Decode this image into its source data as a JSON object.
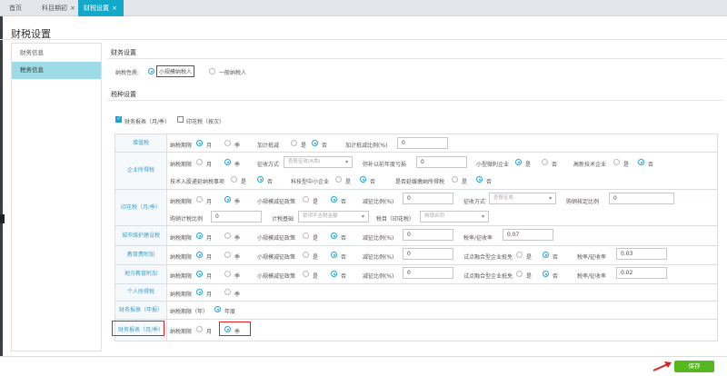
{
  "tabs": [
    {
      "label": "首页"
    },
    {
      "label": "科目期初",
      "close": "×"
    },
    {
      "label": "财税设置",
      "close": "×"
    }
  ],
  "page_title": "财税设置",
  "sidebar": {
    "items": [
      {
        "label": "财务信息"
      },
      {
        "label": "税务信息"
      }
    ]
  },
  "finance_settings": {
    "heading": "财务设置",
    "nature_label": "纳税性质:",
    "small_scale": "小规模纳税人",
    "general": "一般纳税人"
  },
  "tax_settings": {
    "heading": "税种设置",
    "financial_report_check": "财务报表（月/季）",
    "stamp_tax_check": "印花税（按次）"
  },
  "common": {
    "period": "纳税期限",
    "month": "月",
    "quarter": "季",
    "yes": "是",
    "no": "否",
    "year": "年度",
    "period_year": "纳税期限（年）"
  },
  "rows": {
    "vat": {
      "label": "增值税",
      "extra_deduct": "加计抵减",
      "extra_ratio": "加计抵减比例(%)",
      "extra_ratio_value": "0"
    },
    "cit": {
      "label": "企业所得税",
      "method": "征收方式",
      "method_placeholder": "查账征收(A类)",
      "prior_loss": "弥补以前年度亏损",
      "prior_loss_value": "0",
      "small_micro": "小型微利企业",
      "high_tech": "高新技术企业",
      "tech_shares": "技术入股递延纳税事项",
      "tech_sme": "科技型中小企业",
      "remote": "是否延缓缴纳所得税"
    },
    "stamp": {
      "label": "印花税（月/季）",
      "small_relief": "小规模减征政策",
      "relief_ratio": "减征比例(%)",
      "relief_value": "0",
      "method": "征收方式",
      "method_placeholder": "查账征收",
      "purchase_rate": "购销核定比例",
      "purchase_rate_value": "0",
      "purchase_calc": "购销计税比例",
      "purchase_calc_value": "0",
      "basis": "计税基础",
      "basis_placeholder": "销项不含税金额",
      "item": "税目（印花税）",
      "item_placeholder": "购销合同"
    },
    "urban": {
      "label": "城市维护建设税",
      "small_relief": "小规模减征政策",
      "relief_ratio": "减征比例(%)",
      "relief_value": "0",
      "rate": "税率/征收率",
      "rate_value": "0.07"
    },
    "edu": {
      "label": "教育费附加",
      "small_relief": "小规模减征政策",
      "relief_ratio": "减征比例(%)",
      "relief_value": "0",
      "pilot": "试点融合型企业抵免",
      "rate": "税率/征收率",
      "rate_value": "0.03"
    },
    "local_edu": {
      "label": "地方教育附加",
      "small_relief": "小规模减征政策",
      "relief_ratio": "减征比例(%)",
      "relief_value": "0",
      "pilot": "试点融合型企业抵免",
      "rate": "税率/征收率",
      "rate_value": "0.02"
    },
    "pit": {
      "label": "个人所得税"
    },
    "annual": {
      "label": "财务报表（年报）"
    },
    "monthly": {
      "label": "财务报表（月/季）"
    }
  },
  "save_label": "保存",
  "colors": {
    "accent": "#13a8c8",
    "link": "#3b9fcf",
    "save": "#55b81e",
    "highlight": "#e02020",
    "radio": "#1aa3d8"
  }
}
